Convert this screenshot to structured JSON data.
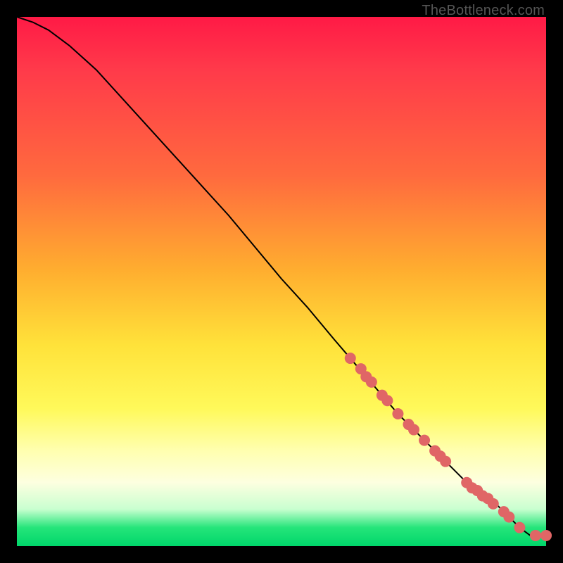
{
  "watermark": "TheBottleneck.com",
  "chart_data": {
    "type": "line",
    "title": "",
    "xlabel": "",
    "ylabel": "",
    "xlim": [
      0,
      100
    ],
    "ylim": [
      0,
      100
    ],
    "grid": false,
    "legend": false,
    "series": [
      {
        "name": "curve",
        "style": "line",
        "color": "#000000",
        "x": [
          0,
          3,
          6,
          10,
          15,
          20,
          25,
          30,
          35,
          40,
          45,
          50,
          55,
          60,
          63,
          66,
          69,
          72,
          75,
          77,
          79,
          81,
          83,
          85,
          87,
          89,
          91,
          93,
          95,
          97,
          98,
          100
        ],
        "y": [
          100,
          99,
          97.5,
          94.5,
          90,
          84.5,
          79,
          73.5,
          68,
          62.5,
          56.5,
          50.5,
          45,
          39,
          35.5,
          32,
          28.5,
          25,
          22,
          20,
          18,
          16,
          14,
          12,
          10.5,
          9,
          7.5,
          5.5,
          3.5,
          2,
          2,
          2
        ]
      },
      {
        "name": "markers",
        "style": "scatter",
        "color": "#e06666",
        "x": [
          63,
          65,
          66,
          67,
          69,
          70,
          72,
          74,
          75,
          77,
          79,
          80,
          81,
          85,
          86,
          87,
          88,
          89,
          90,
          92,
          93,
          95,
          98,
          100
        ],
        "y": [
          35.5,
          33.5,
          32,
          31,
          28.5,
          27.5,
          25,
          23,
          22,
          20,
          18,
          17,
          16,
          12,
          11,
          10.5,
          9.5,
          9,
          8,
          6.5,
          5.5,
          3.5,
          2,
          2
        ]
      }
    ]
  }
}
